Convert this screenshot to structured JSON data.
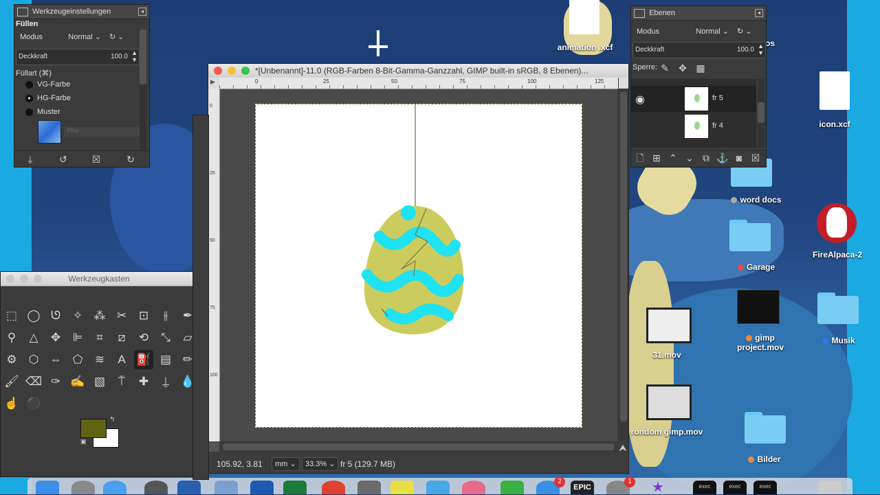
{
  "desktop": {
    "files": [
      {
        "label": "animation .xcf"
      },
      {
        "label": "icon.xcf"
      },
      {
        "label": "word docs"
      },
      {
        "label": "Garage"
      },
      {
        "label": "FireAlpaca-2"
      },
      {
        "label": "gimp project.mov"
      },
      {
        "label": "Musik"
      },
      {
        "label": "31.mov"
      },
      {
        "label": "rondom gimp.mov"
      },
      {
        "label": "Bilder"
      },
      {
        "label": "os"
      }
    ],
    "dock": {
      "badges": [
        "2",
        "1"
      ],
      "labels": [
        "EPIC",
        "exec",
        "exec",
        "exec"
      ]
    }
  },
  "tool_options": {
    "title": "Werkzeugeinstellungen",
    "section": "Füllen",
    "mode_label": "Modus",
    "mode_value": "Normal",
    "opacity_label": "Deckkraft",
    "opacity_value": "100.0",
    "filltype_label": "Füllart  (⌘)",
    "options": [
      "VG-Farbe",
      "HG-Farbe",
      "Muster"
    ],
    "pattern_name": "Pine"
  },
  "layers": {
    "title": "Ebenen",
    "mode_label": "Modus",
    "mode_value": "Normal",
    "opacity_label": "Deckkraft",
    "opacity_value": "100.0",
    "lock_label": "Sperre:",
    "items": [
      {
        "name": "fr 5"
      },
      {
        "name": "fr 4"
      }
    ]
  },
  "image_window": {
    "title": "*[Unbenannt]-11.0 (RGB-Farben 8-Bit-Gamma-Ganzzahl, GIMP built-in sRGB, 8 Ebenen)...",
    "ruler_h": [
      "0",
      "25",
      "50",
      "75",
      "100",
      "125"
    ],
    "ruler_v": [
      "0",
      "25",
      "50",
      "75",
      "100"
    ],
    "coords": "105.92, 3.81",
    "unit": "mm",
    "zoom": "33.3%",
    "status": "fr 5 (129.7 MB)"
  },
  "toolbox": {
    "title": "Werkzeugkasten",
    "fg_color": "#5f6412",
    "bg_color": "#ffffff"
  }
}
